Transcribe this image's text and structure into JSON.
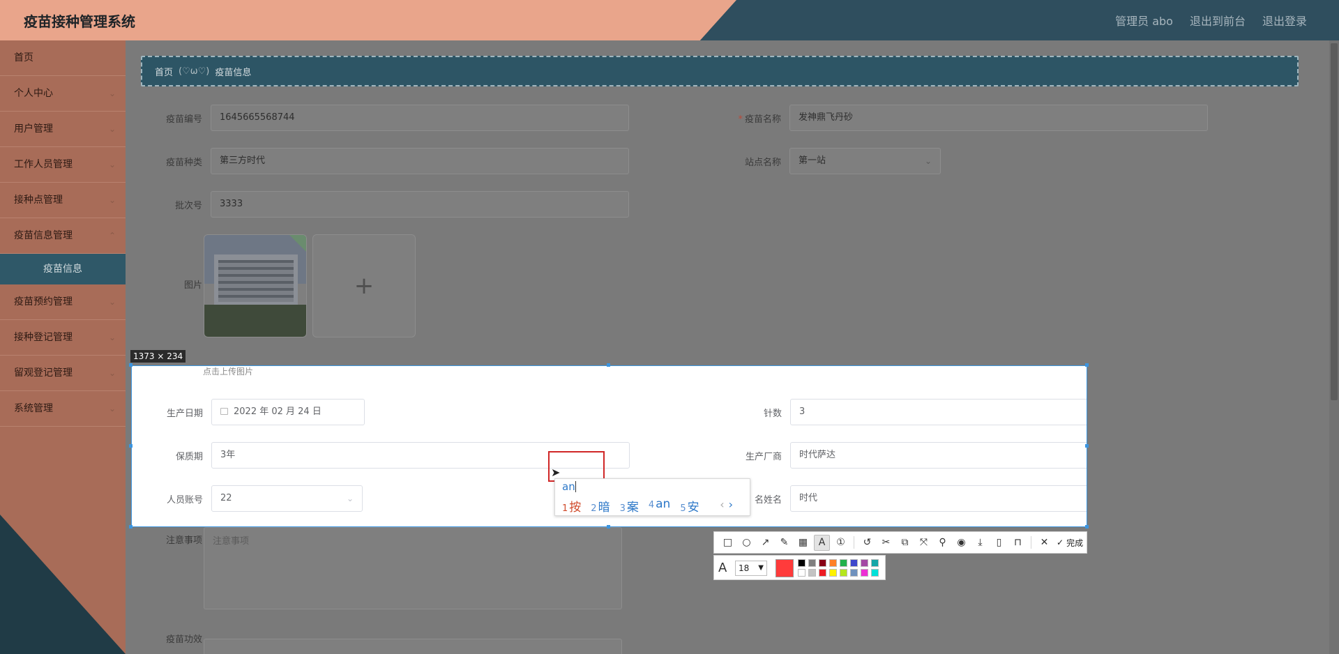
{
  "header": {
    "title": "疫苗接种管理系统",
    "links": [
      "管理员 abo",
      "退出到前台",
      "退出登录"
    ]
  },
  "sidebar": {
    "items": [
      "首页",
      "个人中心",
      "用户管理",
      "工作人员管理",
      "接种点管理",
      "疫苗信息管理"
    ],
    "active_sub": "疫苗信息",
    "items_after": [
      "疫苗预约管理",
      "接种登记管理",
      "留观登记管理",
      "系统管理"
    ]
  },
  "breadcrumb": {
    "home": "首页",
    "sep": "(♡ω♡)",
    "current": "疫苗信息"
  },
  "form": {
    "vaccine_no_label": "疫苗编号",
    "vaccine_no": "1645665568744",
    "vaccine_name_label": "疫苗名称",
    "required_mark": "*",
    "vaccine_name": "发神鼎飞丹砂",
    "vaccine_type_label": "疫苗种类",
    "vaccine_type": "第三方时代",
    "site_label": "站点名称",
    "site": "第一站",
    "batch_label": "批次号",
    "batch": "3333",
    "image_label": "图片",
    "upload_hint": "点击上传图片",
    "prod_date_label": "生产日期",
    "prod_date": "2022 年 02 月 24 日",
    "doses_label": "针数",
    "doses": "3",
    "shelf_label": "保质期",
    "shelf": "3年",
    "maker_label": "生产厂商",
    "maker": "时代萨达",
    "account_label": "人员账号",
    "account": "22",
    "name_label_partial": "名姓名",
    "name_value": "时代",
    "notes_label": "注意事项",
    "notes_placeholder": "注意事项",
    "efficacy_label": "疫苗功效"
  },
  "capture": {
    "size": "1373 × 234",
    "done_label": "完成",
    "font_size": "18",
    "current_color": "#ff3b3b",
    "palette_top": [
      "#000000",
      "#7f7f7f",
      "#880015",
      "#ff7f27",
      "#22b14c",
      "#3f48cc",
      "#a349a4",
      "#15a6a8"
    ],
    "palette_bottom": [
      "#ffffff",
      "#c3c3c3",
      "#ed1c24",
      "#fff200",
      "#b5e61d",
      "#7092be",
      "#ed2fd5",
      "#00e1d9"
    ]
  },
  "ime": {
    "composition": "an",
    "candidates": [
      {
        "num": "1",
        "text": "按"
      },
      {
        "num": "2",
        "text": "暗"
      },
      {
        "num": "3",
        "text": "案"
      },
      {
        "num": "4",
        "text": "an"
      },
      {
        "num": "5",
        "text": "安"
      }
    ]
  }
}
